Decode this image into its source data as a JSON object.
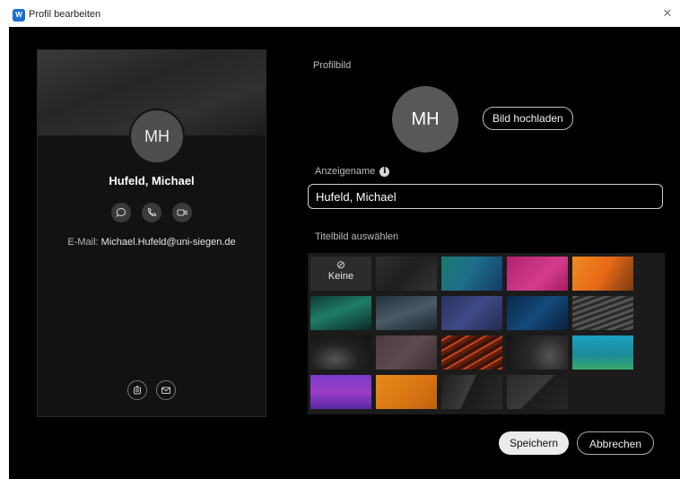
{
  "window": {
    "title": "Profil bearbeiten",
    "app_icon_text": "W"
  },
  "card": {
    "initials": "MH",
    "name": "Hufeld, Michael",
    "email_label": "E-Mail:",
    "email_value": "Michael.Hufeld@uni-siegen.de",
    "action_icons": [
      "chat-icon",
      "phone-icon",
      "video-icon"
    ],
    "bottom_icons": [
      "teams-icon",
      "mail-icon"
    ]
  },
  "profile": {
    "section_label": "Profilbild",
    "initials": "MH",
    "upload_label": "Bild hochladen"
  },
  "display_name": {
    "label": "Anzeigename",
    "value": "Hufeld, Michael"
  },
  "cover": {
    "label": "Titelbild auswählen",
    "none_label": "Keine",
    "none_symbol": "⊘"
  },
  "buttons": {
    "save": "Speichern",
    "cancel": "Abbrechen"
  },
  "colors": {
    "dialog_bg": "#000000",
    "card_bg": "#121212",
    "accent_primary_button": "#ebebeb"
  }
}
